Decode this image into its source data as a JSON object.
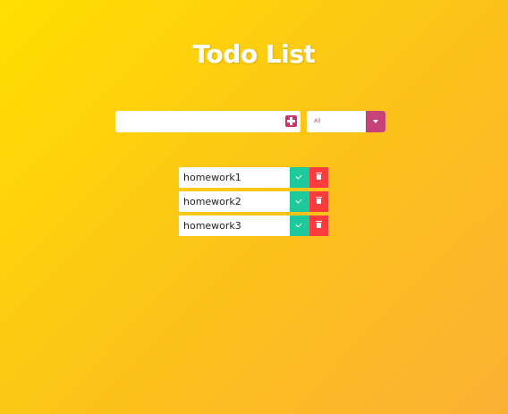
{
  "app": {
    "title": "Todo List"
  },
  "form": {
    "input_value": "",
    "input_placeholder": "",
    "add_icon": "plus-square-icon",
    "filter_selected": "All",
    "filter_icon": "chevron-down-icon"
  },
  "todos": [
    {
      "text": "homework1",
      "complete_icon": "check-icon",
      "delete_icon": "trash-icon"
    },
    {
      "text": "homework2",
      "complete_icon": "check-icon",
      "delete_icon": "trash-icon"
    },
    {
      "text": "homework3",
      "complete_icon": "check-icon",
      "delete_icon": "trash-icon"
    }
  ],
  "colors": {
    "background_start": "#ffdf00",
    "background_end": "#fbb034",
    "accent": "#d0336c",
    "complete_button": "#1ec99b",
    "delete_button": "#ff3b3b"
  }
}
